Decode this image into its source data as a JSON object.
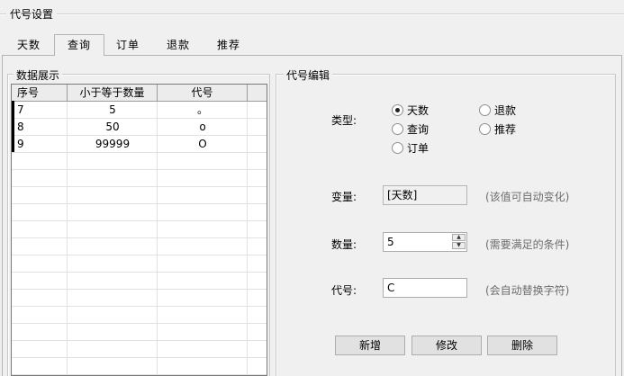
{
  "window": {
    "title": "代号设置"
  },
  "tabs": [
    {
      "label": "天数",
      "active": false
    },
    {
      "label": "查询",
      "active": true
    },
    {
      "label": "订单",
      "active": false
    },
    {
      "label": "退款",
      "active": false
    },
    {
      "label": "推荐",
      "active": false
    }
  ],
  "data_panel": {
    "title": "数据展示",
    "columns": [
      "序号",
      "小于等于数量",
      "代号"
    ],
    "rows": [
      {
        "index": "7",
        "max_qty": "5",
        "code": "。"
      },
      {
        "index": "8",
        "max_qty": "50",
        "code": "o"
      },
      {
        "index": "9",
        "max_qty": "99999",
        "code": "O"
      }
    ]
  },
  "edit_panel": {
    "title": "代号编辑",
    "type_label": "类型:",
    "type_options": [
      {
        "label": "天数",
        "checked": true
      },
      {
        "label": "退款",
        "checked": false
      },
      {
        "label": "查询",
        "checked": false
      },
      {
        "label": "推荐",
        "checked": false
      },
      {
        "label": "订单",
        "checked": false
      }
    ],
    "variable_label": "变量:",
    "variable_value": "[天数]",
    "variable_hint": "(该值可自动变化)",
    "quantity_label": "数量:",
    "quantity_value": "5",
    "quantity_hint": "(需要满足的条件)",
    "code_label": "代号:",
    "code_value": "C",
    "code_hint": "(会自动替换字符)",
    "buttons": {
      "add": "新增",
      "edit": "修改",
      "delete": "删除"
    }
  }
}
